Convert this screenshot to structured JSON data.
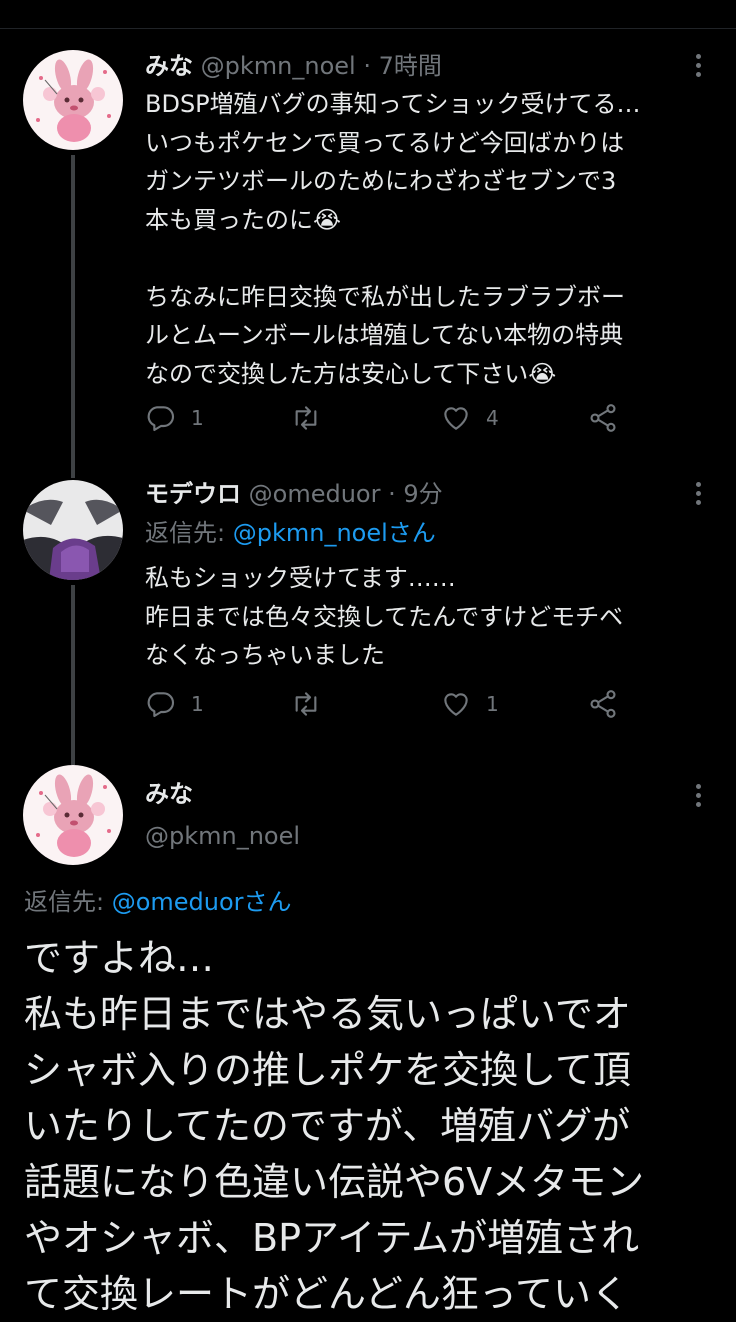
{
  "tweets": [
    {
      "name": "みな",
      "handle": "@pkmn_noel",
      "time": "· 7時間",
      "body": "BDSP増殖バグの事知ってショック受けてる…\nいつもポケセンで買ってるけど今回ばかりは\nガンテツボールのためにわざわざセブンで3\n本も買ったのに😭\n\nちなみに昨日交換で私が出したラブラブボー\nルとムーンボールは増殖してない本物の特典\nなので交換した方は安心して下さい😭",
      "replies": "1",
      "retweets": "",
      "likes": "4"
    },
    {
      "name": "モデウロ",
      "handle": "@omeduor",
      "time": "· 9分",
      "reply_prefix": "返信先: ",
      "reply_handle": "@pkmn_noelさん",
      "body": "私もショック受けてます……\n昨日までは色々交換してたんですけどモチベ\nなくなっちゃいました",
      "replies": "1",
      "retweets": "",
      "likes": "1"
    },
    {
      "name": "みな",
      "handle": "@pkmn_noel",
      "reply_prefix": "返信先: ",
      "reply_handle": "@omeduorさん",
      "body": "ですよね…\n私も昨日まではやる気いっぱいでオ\nシャボ入りの推しポケを交換して頂\nいたりしてたのですが、増殖バグが\n話題になり色違い伝説や6Vメタモン\nやオシャボ、BPアイテムが増殖され\nて交換レートがどんどん狂っていく"
    }
  ],
  "colors": {
    "background": "#000000",
    "text": "#e7e9ea",
    "muted": "#71767b",
    "link": "#1d9bf0",
    "thread_line": "#3e4144"
  }
}
